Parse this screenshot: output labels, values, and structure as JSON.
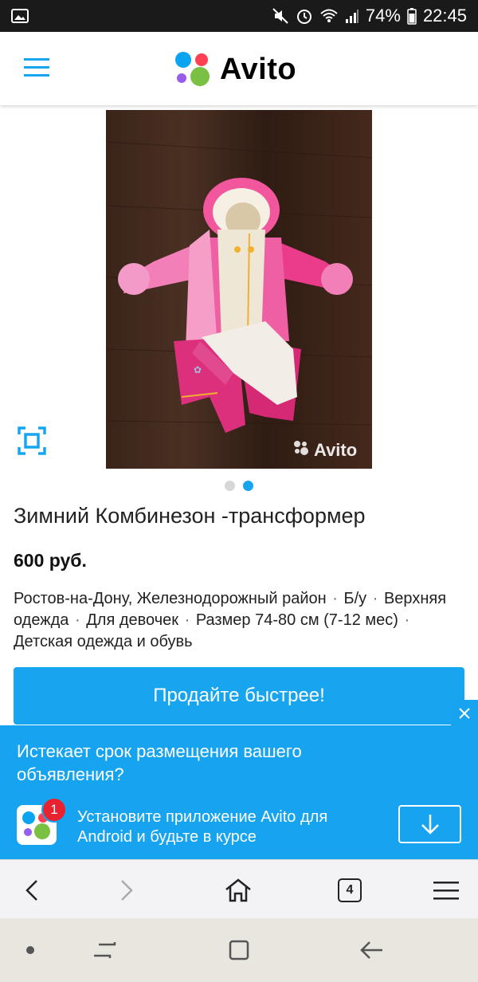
{
  "status_bar": {
    "battery": "74%",
    "time": "22:45"
  },
  "header": {
    "logo_text": "Avito"
  },
  "listing": {
    "watermark": "Avito",
    "gallery_dots_total": 2,
    "gallery_dot_active": 2,
    "title": "Зимний Комбинезон -трансформер",
    "price": "600 руб.",
    "location": "Ростов-на-Дону, Железнодорожный район",
    "condition": "Б/у",
    "category": "Верхняя одежда",
    "gender": "Для девочек",
    "size": "Размер 74-80 см (7-12 мес)",
    "section": "Детская одежда и обувь",
    "separator": "·"
  },
  "promo": {
    "button_label": "Продайте быстрее!"
  },
  "banner": {
    "question": "Истекает срок размещения вашего объявления?",
    "badge_count": "1",
    "install_text": "Установите приложение Avito для Android и будьте в курсе"
  },
  "browser": {
    "tab_count": "4"
  },
  "colors": {
    "accent": "#16a3ef",
    "badge": "#e8232f",
    "logo_blue": "#0aa4f0",
    "logo_red": "#ff4053",
    "logo_purple": "#965eeb",
    "logo_green": "#7ac143"
  }
}
